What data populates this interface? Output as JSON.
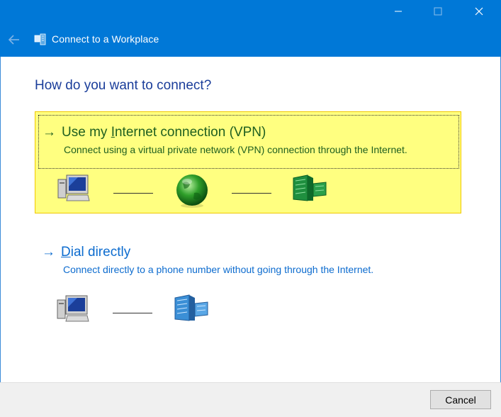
{
  "window": {
    "title": "Connect to a Workplace",
    "controls": [
      "minimize",
      "maximize",
      "close"
    ]
  },
  "heading": "How do you want to connect?",
  "options": [
    {
      "title_parts": [
        "Use my ",
        "I",
        "nternet connection (VPN)"
      ],
      "description": "Connect using a virtual private network (VPN) connection through the Internet.",
      "selected": true,
      "icons": [
        "computer-icon",
        "globe-icon",
        "office-building-icon"
      ]
    },
    {
      "title_parts": [
        "",
        "D",
        "ial directly"
      ],
      "description": "Connect directly to a phone number without going through the Internet.",
      "selected": false,
      "icons": [
        "computer-icon",
        "office-building-icon"
      ]
    }
  ],
  "footer": {
    "cancel_label": "Cancel"
  },
  "colors": {
    "titlebar": "#0078d7",
    "heading": "#1a3d9a",
    "link": "#0d6ccf",
    "selected_bg": "#ffff80",
    "selected_text": "#1f5f1f"
  }
}
